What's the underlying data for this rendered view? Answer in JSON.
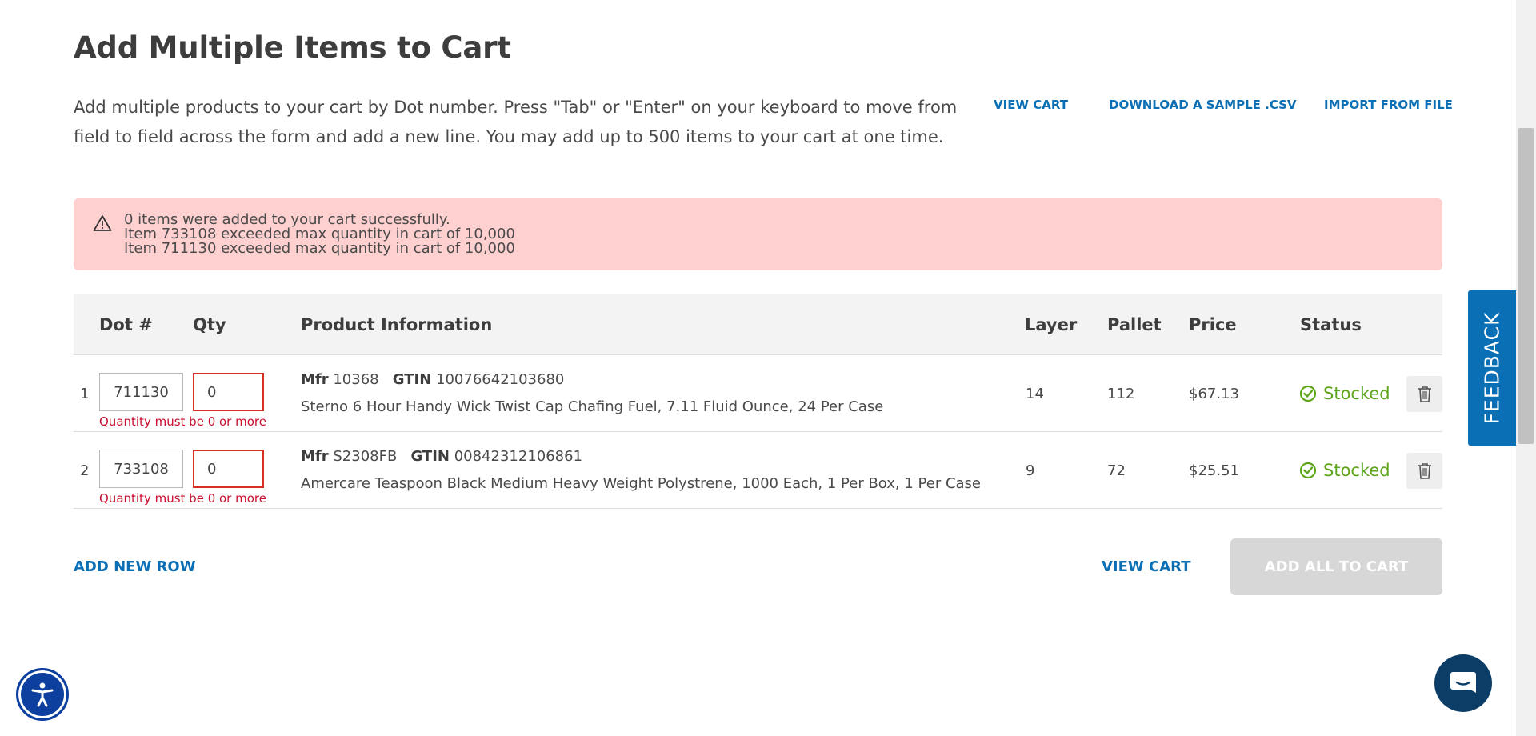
{
  "page": {
    "title": "Add Multiple Items to Cart",
    "description": "Add multiple products to your cart by Dot number. Press \"Tab\" or \"Enter\" on your keyboard to move from field to field across the form and add a new line. You may add up to 500 items to your cart at one time."
  },
  "top_links": {
    "view_cart": "VIEW CART",
    "download_csv": "DOWNLOAD A SAMPLE .CSV",
    "import_file": "IMPORT FROM FILE"
  },
  "alert": {
    "icon": "warning-triangle-icon",
    "messages": [
      "0 items were added to your cart successfully.",
      "Item 733108 exceeded max quantity in cart of 10,000",
      "Item 711130 exceeded max quantity in cart of 10,000"
    ]
  },
  "table": {
    "headers": {
      "dot": "Dot #",
      "qty": "Qty",
      "product": "Product Information",
      "layer": "Layer",
      "pallet": "Pallet",
      "price": "Price",
      "status": "Status"
    },
    "mfr_label": "Mfr",
    "gtin_label": "GTIN",
    "rows": [
      {
        "num": "1",
        "dot": "711130",
        "qty": "0",
        "error": "Quantity must be 0 or more",
        "mfr": "10368",
        "gtin": "10076642103680",
        "description": "Sterno 6 Hour Handy Wick Twist Cap Chafing Fuel, 7.11 Fluid Ounce, 24 Per Case",
        "layer": "14",
        "pallet": "112",
        "price": "$67.13",
        "status": "Stocked"
      },
      {
        "num": "2",
        "dot": "733108",
        "qty": "0",
        "error": "Quantity must be 0 or more",
        "mfr": "S2308FB",
        "gtin": "00842312106861",
        "description": "Amercare Teaspoon Black Medium Heavy Weight Polystrene, 1000 Each, 1 Per Box, 1 Per Case",
        "layer": "9",
        "pallet": "72",
        "price": "$25.51",
        "status": "Stocked"
      }
    ]
  },
  "actions": {
    "add_new_row": "ADD NEW ROW",
    "view_cart": "VIEW CART",
    "add_all": "ADD ALL TO CART"
  },
  "feedback": {
    "label": "FEEDBACK"
  },
  "colors": {
    "link": "#0a6fb5",
    "error": "#c8102e",
    "alert_bg": "#ffd0d0",
    "stocked": "#5ea51b",
    "disabled_button": "#d7d7d7"
  }
}
